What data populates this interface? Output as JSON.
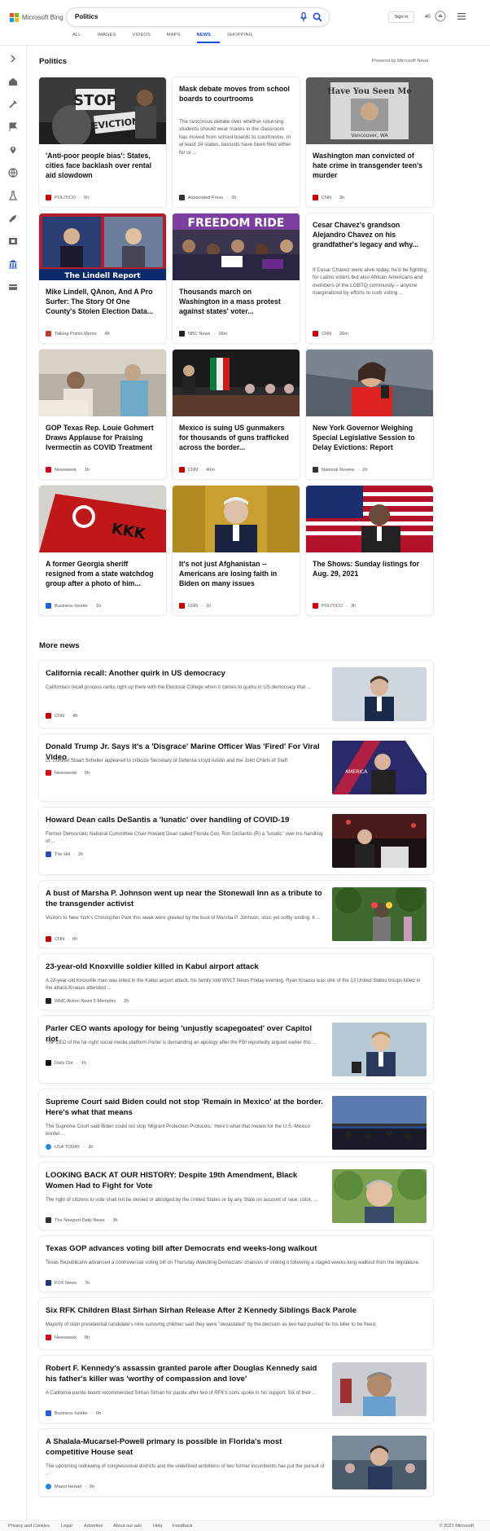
{
  "header": {
    "logo_text": "Microsoft Bing",
    "search_value": "Politics",
    "tabs": [
      "ALL",
      "IMAGES",
      "VIDEOS",
      "MAPS",
      "NEWS",
      "SHOPPING"
    ],
    "active_tab": "NEWS",
    "signin_label": "Sign in",
    "rewards_count": "40"
  },
  "section_politics": {
    "title": "Politics",
    "powered_by": "Powered by Microsoft News"
  },
  "cards": [
    {
      "title": "'Anti-poor people bias': States, cities face backlash over rental aid slowdown",
      "source": "POLITICO",
      "time": "5h",
      "logo_color": "#d40000"
    },
    {
      "title": "Mask debate moves from school boards to courtrooms",
      "desc": "The rancorous debate over whether returning students should wear masks in the classroom has moved from school boards to courtrooms. In at least 14 states, lawsuits have been filed either for or ...",
      "source": "Associated Press",
      "time": "3h",
      "logo_color": "#333333"
    },
    {
      "title": "Washington man convicted of hate crime in transgender teen's murder",
      "source": "CNN",
      "time": "3h",
      "logo_color": "#cc0000"
    },
    {
      "title": "Mike Lindell, QAnon, And A Pro Surfer: The Story Of One County's Stolen Election Data...",
      "source": "Talking Points Memo",
      "time": "4h",
      "logo_color": "#c0392b"
    },
    {
      "title": "Thousands march on Washington in a mass protest against states' voter...",
      "source": "NBC News",
      "time": "28m",
      "logo_color": "#222222"
    },
    {
      "title": "Cesar Chavez's grandson Alejandro Chavez on his grandfather's legacy and why...",
      "desc": "If Cesar Chavez were alive today, he'd be fighting for Latino voters but also African Americans and members of the LGBTQ community – anyone marginalized by efforts to curb voting ...",
      "source": "CNN",
      "time": "26m",
      "logo_color": "#cc0000"
    },
    {
      "title": "GOP Texas Rep. Louie Gohmert Draws Applause for Praising Ivermectin as COVID Treatment",
      "source": "Newsweek",
      "time": "1h",
      "logo_color": "#e0001b"
    },
    {
      "title": "Mexico is suing US gunmakers for thousands of guns trafficked across the border...",
      "source": "CNN",
      "time": "40m",
      "logo_color": "#cc0000"
    },
    {
      "title": "New York Governor Weighing Special Legislative Session to Delay Evictions: Report",
      "source": "National Review",
      "time": "2h",
      "logo_color": "#333333"
    },
    {
      "title": "A former Georgia sheriff resigned from a state watchdog group after a photo of him...",
      "source": "Business Insider",
      "time": "1h",
      "logo_color": "#1f5fe0"
    },
    {
      "title": "It's not just Afghanistan -- Americans are losing faith in Biden on many issues",
      "source": "CNN",
      "time": "1h",
      "logo_color": "#cc0000"
    },
    {
      "title": "The Shows: Sunday listings for Aug. 29, 2021",
      "source": "POLITICO",
      "time": "3h",
      "logo_color": "#d40000"
    }
  ],
  "section_more": {
    "title": "More news"
  },
  "more_news": [
    {
      "title": "California recall: Another quirk in US democracy",
      "desc": "California's recall process ranks right up there with the Electoral College when it comes to quirks in US democracy that ...",
      "source": "CNN",
      "time": "4h",
      "logo_color": "#cc0000"
    },
    {
      "title": "Donald Trump Jr. Says It's a 'Disgrace' Marine Officer Was 'Fired' For Viral Video",
      "desc": "Lt. Colonel Stuart Scheller appeared to criticize Secretary of Defense Lloyd Austin and the Joint Chiefs of Staff.",
      "source": "Newsweek",
      "time": "5h",
      "logo_color": "#e0001b"
    },
    {
      "title": "Howard Dean calls DeSantis a 'lunatic' over handling of COVID-19",
      "desc": "Former Democratic National Committee Chair Howard Dean called Florida Gov. Ron DeSantis (R) a \"lunatic\" over his handling of ...",
      "source": "The Hill",
      "time": "2h",
      "logo_color": "#2a4fb0"
    },
    {
      "title": "A bust of Marsha P. Johnson went up near the Stonewall Inn as a tribute to the transgender activist",
      "desc": "Visitors to New York's Christopher Park this week were greeted by the bust of Marsha P. Johnson, stoic yet softly smiling. It ...",
      "source": "CNN",
      "time": "6h",
      "logo_color": "#cc0000"
    },
    {
      "title": "23-year-old Knoxville soldier killed in Kabul airport attack",
      "desc": "A 23-year-old Knoxville man was killed in the Kabul airport attack, his family told WVLT News Friday evening. Ryan Knauss was one of the 13 United States troops killed in the attack.Knauss attended ...",
      "source": "WMC Action News 5 Memphis",
      "time": "2h",
      "logo_color": "#222222"
    },
    {
      "title": "Parler CEO wants apology for being 'unjustly scapegoated' over Capitol riot",
      "desc": "The CEO of the far-right social media platform Parler is demanding an apology after the FBI reportedly argued earlier this ...",
      "source": "Daily Dot",
      "time": "1h",
      "logo_color": "#111111"
    },
    {
      "title": "Supreme Court said Biden could not stop 'Remain in Mexico' at the border. Here's what that means",
      "desc": "The Supreme Court said Biden could not stop 'Migrant Protection Protocols.' Here's what that means for the U.S.-Mexico border ...",
      "source": "USA TODAY",
      "time": "3h",
      "logo_color": "#1e88e5"
    },
    {
      "title": "LOOKING BACK AT OUR HISTORY: Despite 19th Amendment, Black Women Had to Fight for Vote",
      "desc": "The right of citizens to vote shall not be denied or abridged by the United States or by any State on account of race, color, ...",
      "source": "The Newport Daily News",
      "time": "3h",
      "logo_color": "#333333"
    },
    {
      "title": "Texas GOP advances voting bill after Democrats end weeks-long walkout",
      "desc": "Texas Republicans advanced a controversial voting bill on Thursday dwindling Democrats' chances of sinking it following a staged weeks-long walkout from the legislature.",
      "source": "FOX News",
      "time": "7h",
      "logo_color": "#1a3a7a"
    },
    {
      "title": "Six RFK Children Blast Sirhan Sirhan Release After 2 Kennedy Siblings Back Parole",
      "desc": "Majority of slain presidential candidate's nine surviving children said they were \"devastated\" by the decision as two had pushed for his killer to be freed.",
      "source": "Newsweek",
      "time": "8h",
      "logo_color": "#e0001b"
    },
    {
      "title": "Robert F. Kennedy's assassin granted parole after Douglas Kennedy said his father's killer was 'worthy of compassion and love'",
      "desc": "A California parole board recommended Sirhan Sirhan for parole after two of RFK's sons spoke in his support. Six of their ...",
      "source": "Business Insider",
      "time": "6h",
      "logo_color": "#1f5fe0"
    },
    {
      "title": "A Shalala-Mucarsel-Powell primary is possible in Florida's most competitive House seat",
      "desc": "The upcoming redrawing of congressional districts and the undefined ambitions of two former incumbents has put the pursuit of ...",
      "source": "Miami Herald",
      "time": "6h",
      "logo_color": "#1e88e5"
    }
  ],
  "footer": {
    "links": [
      "Privacy and Cookies",
      "Legal",
      "Advertise",
      "About our ads",
      "Help",
      "Feedback"
    ],
    "copyright": "© 2021 Microsoft"
  },
  "colors": {
    "accent": "#174ae4",
    "logo_red": "#f25022",
    "logo_green": "#7fba00",
    "logo_blue": "#00a4ef",
    "logo_yellow": "#ffb900"
  },
  "icons": [
    "menu-icon",
    "mic-icon",
    "search-icon",
    "rewards-icon",
    "home-icon",
    "flag-icon",
    "pin-icon",
    "globe-icon",
    "rocket-icon"
  ]
}
